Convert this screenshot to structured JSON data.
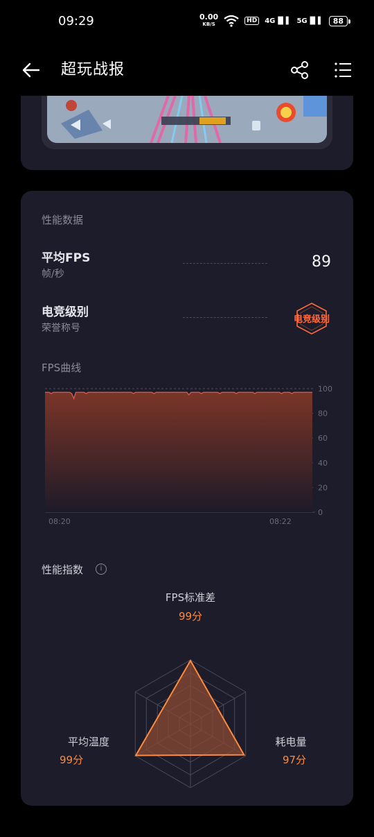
{
  "status_bar": {
    "time": "09:29",
    "net_speed": "0.00",
    "net_unit": "KB/S",
    "hd": "HD",
    "sig1": "4G",
    "sig2": "5G",
    "battery": "88"
  },
  "appbar": {
    "title": "超玩战报"
  },
  "performance": {
    "section_label": "性能数据",
    "avg_fps_title": "平均FPS",
    "avg_fps_unit": "帧/秒",
    "avg_fps_value": "89",
    "esports_title": "电竞级别",
    "esports_sub": "荣誉称号",
    "esports_badge": "电竞级别"
  },
  "fps_curve": {
    "label": "FPS曲线"
  },
  "chart_data": {
    "type": "area",
    "title": "FPS曲线",
    "x_ticks": [
      "08:20",
      "08:22"
    ],
    "y_ticks": [
      0,
      20,
      40,
      60,
      80,
      100
    ],
    "ylim": [
      0,
      100
    ],
    "grid": true,
    "values": [
      97,
      97,
      97,
      96,
      97,
      97,
      97,
      97,
      97,
      97,
      97,
      97,
      97,
      96,
      92,
      97,
      97,
      97,
      97,
      97,
      96,
      97,
      97,
      97,
      97,
      97,
      97,
      97,
      97,
      97,
      97,
      97,
      97,
      97,
      97,
      97,
      97,
      97,
      97,
      97,
      97,
      97,
      97,
      96,
      97,
      97,
      97,
      97,
      97,
      97,
      97,
      97,
      97,
      96,
      97,
      97,
      97,
      97,
      97,
      97,
      97,
      97,
      97,
      97,
      97,
      97,
      97,
      97,
      97,
      97,
      95,
      97,
      97,
      97,
      97,
      97,
      96,
      97,
      97,
      97,
      97,
      97,
      97,
      97,
      97,
      96,
      97,
      97,
      97,
      97,
      97,
      97,
      97,
      96,
      97,
      97,
      97,
      97,
      97,
      97,
      97,
      97,
      96,
      97,
      97,
      97,
      97,
      97,
      97,
      97,
      97,
      97,
      97,
      97,
      97,
      96,
      97,
      97,
      97,
      97,
      96,
      97,
      97,
      97,
      97,
      97,
      97,
      97,
      97,
      97,
      97
    ]
  },
  "performance_index": {
    "label": "性能指数",
    "info_icon": "i",
    "axes": [
      {
        "name": "FPS标准差",
        "score": "99分",
        "value": 99
      },
      {
        "name": "耗电量",
        "score": "97分",
        "value": 97
      },
      {
        "name": "平均温度",
        "score": "99分",
        "value": 99
      }
    ],
    "accent_color": "#ff8a3d"
  }
}
